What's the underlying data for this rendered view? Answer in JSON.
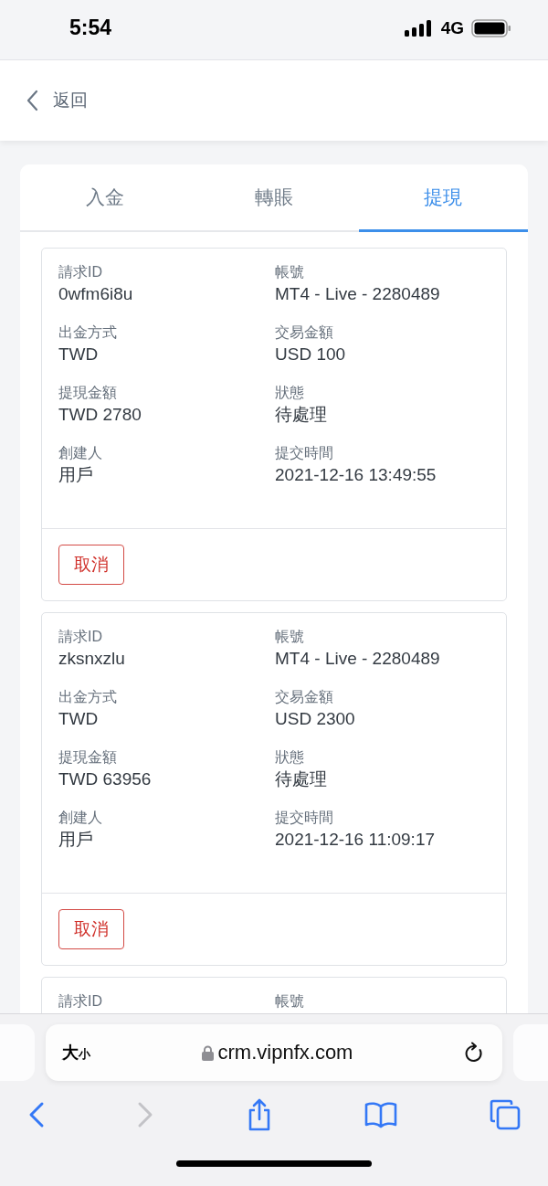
{
  "status_bar": {
    "time": "5:54",
    "network": "4G"
  },
  "header": {
    "back_label": "返回"
  },
  "tabs": [
    {
      "label": "入金",
      "selected": false
    },
    {
      "label": "轉賬",
      "selected": false
    },
    {
      "label": "提現",
      "selected": true
    }
  ],
  "records": [
    {
      "fields": [
        {
          "label": "請求ID",
          "value": "0wfm6i8u"
        },
        {
          "label": "帳號",
          "value": "MT4 - Live - 2280489"
        },
        {
          "label": "出金方式",
          "value": "TWD"
        },
        {
          "label": "交易金額",
          "value": "USD 100"
        },
        {
          "label": "提現金額",
          "value": "TWD 2780"
        },
        {
          "label": "狀態",
          "value": "待處理"
        },
        {
          "label": "創建人",
          "value": "用戶"
        },
        {
          "label": "提交時間",
          "value": "2021-12-16 13:49:55"
        }
      ],
      "cancel_button": "取消"
    },
    {
      "fields": [
        {
          "label": "請求ID",
          "value": "zksnxzlu"
        },
        {
          "label": "帳號",
          "value": "MT4 - Live - 2280489"
        },
        {
          "label": "出金方式",
          "value": "TWD"
        },
        {
          "label": "交易金額",
          "value": "USD 2300"
        },
        {
          "label": "提現金額",
          "value": "TWD 63956"
        },
        {
          "label": "狀態",
          "value": "待處理"
        },
        {
          "label": "創建人",
          "value": "用戶"
        },
        {
          "label": "提交時間",
          "value": "2021-12-16 11:09:17"
        }
      ],
      "cancel_button": "取消"
    },
    {
      "fields": [
        {
          "label": "請求ID"
        },
        {
          "label": "帳號"
        }
      ]
    }
  ],
  "browser": {
    "text_size": {
      "large": "大",
      "small": "小"
    },
    "url": "crm.vipnfx.com",
    "toolbar": [
      {
        "kind": "back",
        "disabled": false
      },
      {
        "kind": "forward",
        "disabled": true
      },
      {
        "kind": "share",
        "disabled": false
      },
      {
        "kind": "bookmarks",
        "disabled": false
      },
      {
        "kind": "tabs",
        "disabled": false
      }
    ]
  }
}
